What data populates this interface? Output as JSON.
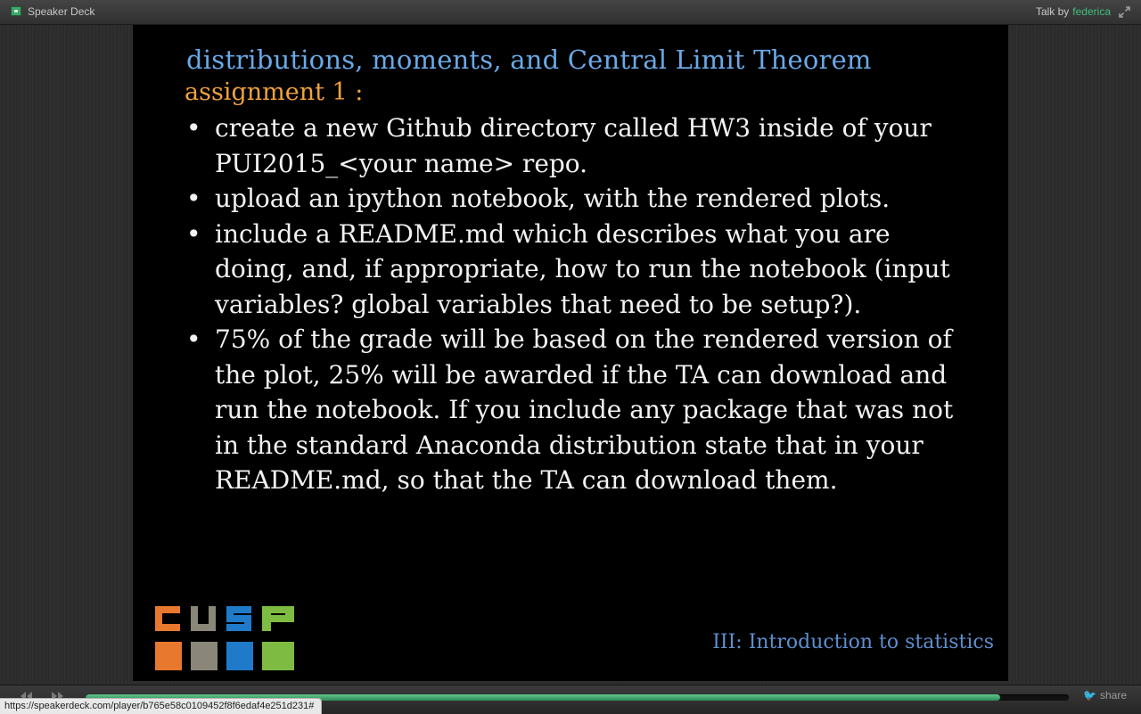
{
  "topbar": {
    "brand": "Speaker Deck",
    "talk_by_label": "Talk by",
    "author": "federica"
  },
  "slide": {
    "title_line1": "distributions, moments, and  Central Limit Theorem",
    "title_line2": "assignment 1 :",
    "bullets": [
      "create a new Github directory called HW3 inside of your PUI2015_<your name> repo.",
      "upload an ipython notebook, with the rendered plots.",
      "include a README.md which describes what you are doing, and, if appropriate, how to run the notebook (input variables? global variables that need to be setup?).",
      "75% of the grade will be based on the rendered version of the plot, 25% will be awarded if the TA can download and run the notebook. If you include any package that was not in the standard Anaconda distribution state that in your README.md, so that the TA can download them."
    ],
    "footer": "III: Introduction to statistics",
    "logo_text": "CUSP",
    "logo_colors": [
      "#e8782e",
      "#8a8678",
      "#1f7bc9",
      "#7dbb42"
    ]
  },
  "player": {
    "progress": 0.93,
    "share_label": "share",
    "progress_color": "#3fa66a"
  },
  "status_url": "https://speakerdeck.com/player/b765e58c0109452f8f6edaf4e251d231#"
}
